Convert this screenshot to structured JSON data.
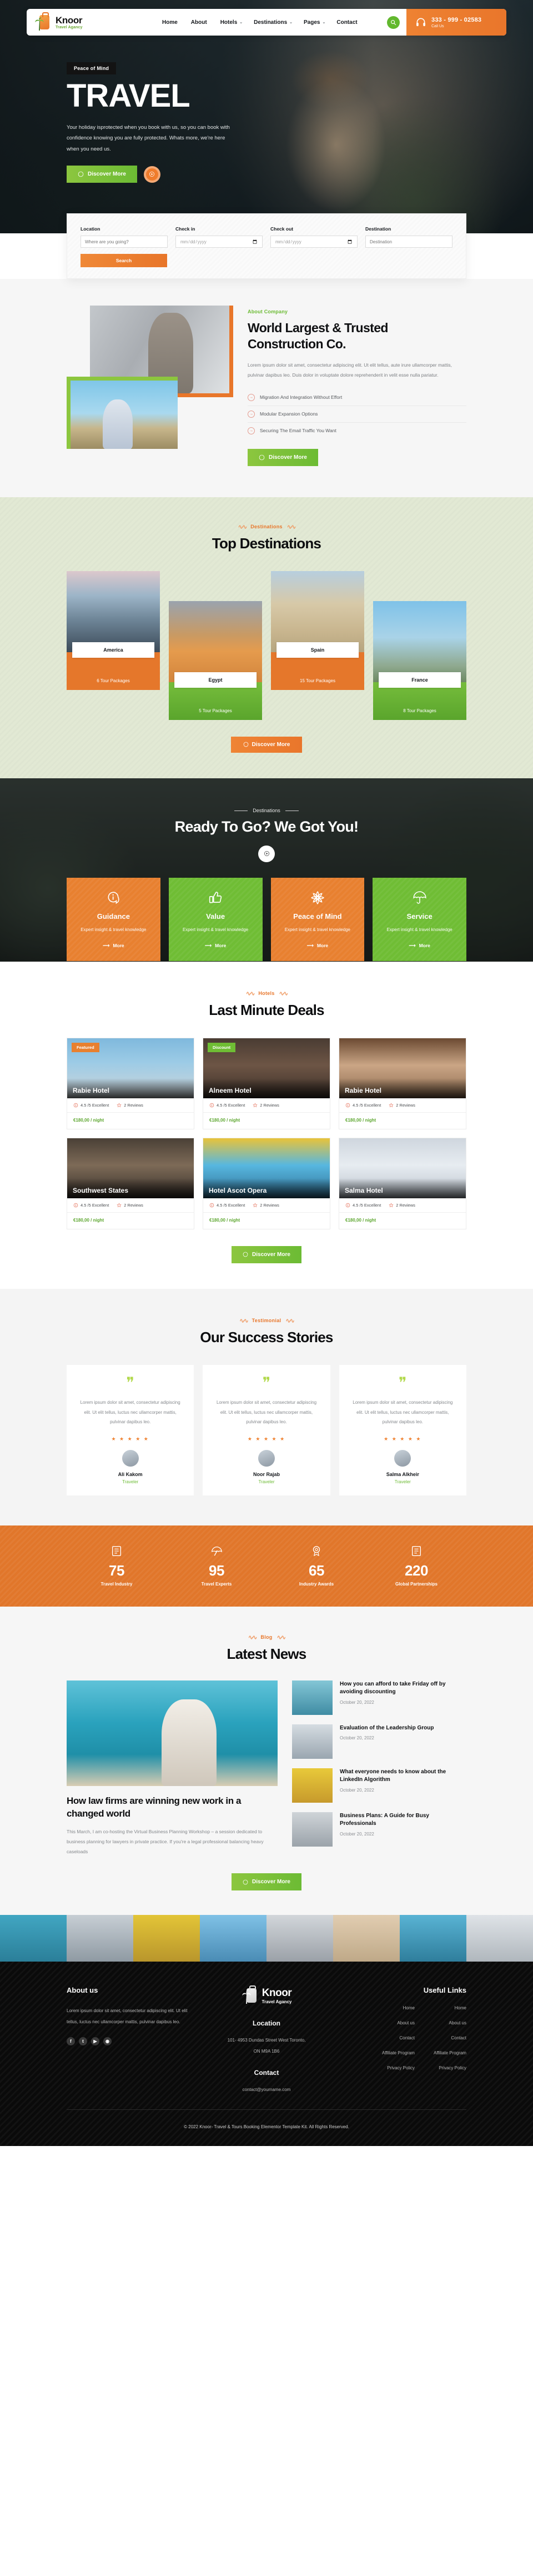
{
  "nav": {
    "brand_name": "Knoor",
    "brand_sub": "Travel Agancy",
    "links": [
      {
        "label": "Home",
        "caret": ""
      },
      {
        "label": "About",
        "caret": ""
      },
      {
        "label": "Hotels",
        "caret": "⌄"
      },
      {
        "label": "Destinations",
        "caret": "⌄"
      },
      {
        "label": "Pages",
        "caret": "⌄"
      },
      {
        "label": "Contact",
        "caret": ""
      }
    ],
    "phone": "333 - 999 - 02583",
    "call_label": "Call Us"
  },
  "hero": {
    "badge": "Peace of Mind",
    "title": "TRAVEL",
    "subtitle": "Your holiday isprotected when you book with us, so you can book with confidence knowing you are fully protected. Whats more, we're here when you need us.",
    "cta": "Discover More"
  },
  "booking": {
    "fields": [
      {
        "label": "Location",
        "placeholder": "Where are you going?",
        "type": "text"
      },
      {
        "label": "Check in",
        "placeholder": "mm/dd/yyyy",
        "type": "date"
      },
      {
        "label": "Check out",
        "placeholder": "mm/dd/yyyy",
        "type": "date"
      },
      {
        "label": "Destination",
        "placeholder": "Destination",
        "type": "text"
      }
    ],
    "search_label": "Search"
  },
  "about": {
    "eyebrow": "About Company",
    "title": "World Largest & Trusted Construction Co.",
    "paragraph": "Lorem ipsum dolor sit amet, consectetur adipiscing elit. Ut elit tellus, aute irure ullamcorper mattis, pulvinar dapibus leo. Duis dolor in voluptate dolore reprehenderit in velit esse nulla pariatur.",
    "features": [
      "Migration And Integration Without Effort",
      "Modular Expansion Options",
      "Securing The Email Traffic You Want"
    ],
    "cta": "Discover More"
  },
  "destinations": {
    "eyebrow": "Destinations",
    "title": "Top Destinations",
    "cards": [
      {
        "name": "America",
        "packages": "6 Tour Packages",
        "color": "orange",
        "photo": "ph-america",
        "offset": false
      },
      {
        "name": "Egypt",
        "packages": "5 Tour Packages",
        "color": "green",
        "photo": "ph-egypt",
        "offset": true
      },
      {
        "name": "Spain",
        "packages": "15 Tour Packages",
        "color": "orange",
        "photo": "ph-spain",
        "offset": false
      },
      {
        "name": "France",
        "packages": "8 Tour Packages",
        "color": "green",
        "photo": "ph-france",
        "offset": true
      }
    ],
    "cta": "Discover More"
  },
  "ready": {
    "eyebrow": "Destinations",
    "title": "Ready To Go? We Got You!",
    "cards": [
      {
        "title": "Guidance",
        "text": "Expert insight & travel knowledge",
        "more": "More",
        "color": "o",
        "icon": "info-icon"
      },
      {
        "title": "Value",
        "text": "Expert insight & travel knowledge",
        "more": "More",
        "color": "g",
        "icon": "thumbs-up-icon"
      },
      {
        "title": "Peace of Mind",
        "text": "Expert insight & travel knowledge",
        "more": "More",
        "color": "o",
        "icon": "flower-icon"
      },
      {
        "title": "Service",
        "text": "Expert insight & travel knowledge",
        "more": "More",
        "color": "g",
        "icon": "umbrella-icon"
      }
    ]
  },
  "deals": {
    "eyebrow": "Hotels",
    "title": "Last Minute Deals",
    "cards": [
      {
        "name": "Rabie Hotel",
        "tag": "Featured",
        "tag_type": "feat",
        "rating": "4.5 /5 Excellent",
        "reviews": "2 Reviews",
        "price": "€180,00 / night",
        "img": "im1"
      },
      {
        "name": "Alneem Hotel",
        "tag": "Discount",
        "tag_type": "disc",
        "rating": "4.5 /5 Excellent",
        "reviews": "2 Reviews",
        "price": "€180,00 / night",
        "img": "im2"
      },
      {
        "name": "Rabie Hotel",
        "tag": "",
        "tag_type": "",
        "rating": "4.5 /5 Excellent",
        "reviews": "2 Reviews",
        "price": "€180,00 / night",
        "img": "im3"
      },
      {
        "name": "Southwest States",
        "tag": "",
        "tag_type": "",
        "rating": "4.5 /5 Excellent",
        "reviews": "2 Reviews",
        "price": "€180,00 / night",
        "img": "im4"
      },
      {
        "name": "Hotel Ascot Opera",
        "tag": "",
        "tag_type": "",
        "rating": "4.5 /5 Excellent",
        "reviews": "2 Reviews",
        "price": "€180,00 / night",
        "img": "im5"
      },
      {
        "name": "Salma Hotel",
        "tag": "",
        "tag_type": "",
        "rating": "4.5 /5 Excellent",
        "reviews": "2 Reviews",
        "price": "€180,00 / night",
        "img": "im6"
      }
    ],
    "cta": "Discover More"
  },
  "testimonials": {
    "eyebrow": "Testimonial",
    "title": "Our Success Stories",
    "items": [
      {
        "text": "Lorem ipsum dolor sit amet, consectetur adipiscing elit. Ut elit tellus, luctus nec ullamcorper mattis, pulvinar dapibus leo.",
        "stars": "★ ★ ★ ★ ★",
        "name": "Ali Kakom",
        "role": "Traveler"
      },
      {
        "text": "Lorem ipsum dolor sit amet, consectetur adipiscing elit. Ut elit tellus, luctus nec ullamcorper mattis, pulvinar dapibus leo.",
        "stars": "★ ★ ★ ★ ★",
        "name": "Noor Rajab",
        "role": "Traveler"
      },
      {
        "text": "Lorem ipsum dolor sit amet, consectetur adipiscing elit. Ut elit tellus, luctus nec ullamcorper mattis, pulvinar dapibus leo.",
        "stars": "★ ★ ★ ★ ★",
        "name": "Salma Alkheir",
        "role": "Traveler"
      }
    ]
  },
  "counters": [
    {
      "value": "75",
      "label": "Travel Industry",
      "icon": "document-icon"
    },
    {
      "value": "95",
      "label": "Travel Experts",
      "icon": "umbrella-beach-icon"
    },
    {
      "value": "65",
      "label": "Industry Awards",
      "icon": "medal-icon"
    },
    {
      "value": "220",
      "label": "Global Partnerships",
      "icon": "document-icon"
    }
  ],
  "blog": {
    "eyebrow": "Blog",
    "title": "Latest News",
    "main": {
      "title": "How law firms are winning new work in a changed world",
      "excerpt": "This March, I am co-hosting the Virtual Business Planning Workshop – a session dedicated to business planning for lawyers in private practice. If you're a legal professional balancing heavy caseloads"
    },
    "side": [
      {
        "title": "How you can afford to take Friday off by avoiding discounting",
        "date": "October 20, 2022",
        "thumb": "st1"
      },
      {
        "title": "Evaluation of the Leadership Group",
        "date": "October 20, 2022",
        "thumb": "st2"
      },
      {
        "title": "What everyone needs to know about the LinkedIn Algorithm",
        "date": "October 20, 2022",
        "thumb": "st3"
      },
      {
        "title": "Business Plans: A Guide for Busy Professionals",
        "date": "October 20, 2022",
        "thumb": "st4"
      }
    ],
    "cta": "Discover More"
  },
  "footer": {
    "about_heading": "About us",
    "about_text": "Lorem ipsum dolor sit amet, consectetur adipiscing elit. Ut elit tellus, luctus nec ullamcorper mattis, pulvinar dapibus leo.",
    "socials": [
      "f",
      "t",
      "▶",
      "◉"
    ],
    "brand_name": "Knoor",
    "brand_sub": "Travel Agancy",
    "location_heading": "Location",
    "address_line1": "101- 4953 Dundas Street West Toronto,",
    "address_line2": "ON M9A 1B6",
    "contact_heading": "Contact",
    "email": "contact@yourname.com",
    "links_heading": "Useful Links",
    "links_col1": [
      "Home",
      "About us",
      "Contact",
      "Affiliate Program",
      "Privacy Policy"
    ],
    "links_col2": [
      "Home",
      "About us",
      "Contact",
      "Affiliate Program",
      "Privacy Policy"
    ],
    "copyright": "© 2022 Knoor- Travel & Tours Booking Elementor Template Kit. All Rights Reserved."
  }
}
